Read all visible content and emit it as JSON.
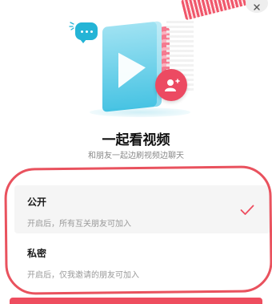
{
  "dialog": {
    "title": "一起看视频",
    "subtitle": "和朋友一起边刷视频边聊天"
  },
  "options": [
    {
      "label": "公开",
      "description": "开启后，所有互关朋友可加入",
      "selected": true
    },
    {
      "label": "私密",
      "description": "开启后，仅我邀请的朋友可加入",
      "selected": false
    }
  ],
  "icons": {
    "close": "close-icon",
    "check": "check-icon",
    "chat": "chat-bubble-icon",
    "play": "play-icon",
    "add_friend": "add-friend-icon"
  },
  "colors": {
    "accent": "#ee4d5f",
    "hero_blue": "#47c3e3",
    "annotation_outline": "#e9525e"
  }
}
